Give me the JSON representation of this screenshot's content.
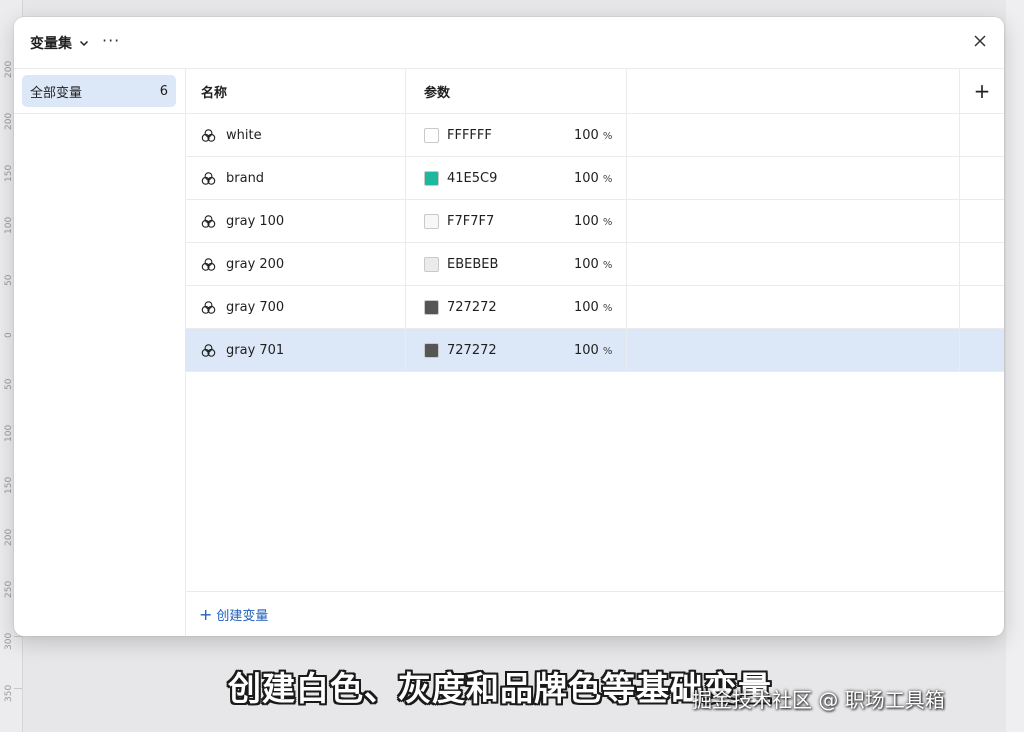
{
  "ruler": {
    "ticks": [
      "200",
      "200",
      "150",
      "100",
      "50",
      "0",
      "50",
      "100",
      "150",
      "200",
      "250",
      "300",
      "350"
    ]
  },
  "dialog": {
    "title": "变量集",
    "more": "···",
    "sidebar": {
      "items": [
        {
          "label": "全部变量",
          "count": "6"
        }
      ]
    },
    "table": {
      "headers": {
        "name": "名称",
        "value": "参数",
        "add": "+"
      },
      "rows": [
        {
          "name": "white",
          "hex": "FFFFFF",
          "opacity": "100",
          "unit": "%",
          "color": "#FFFFFF",
          "selected": false
        },
        {
          "name": "brand",
          "hex": "41E5C9",
          "opacity": "100",
          "unit": "%",
          "color": "#1FB89E",
          "selected": false
        },
        {
          "name": "gray 100",
          "hex": "F7F7F7",
          "opacity": "100",
          "unit": "%",
          "color": "#F7F7F7",
          "selected": false
        },
        {
          "name": "gray 200",
          "hex": "EBEBEB",
          "opacity": "100",
          "unit": "%",
          "color": "#EBEBEB",
          "selected": false
        },
        {
          "name": "gray 700",
          "hex": "727272",
          "opacity": "100",
          "unit": "%",
          "color": "#555555",
          "selected": false
        },
        {
          "name": "gray 701",
          "hex": "727272",
          "opacity": "100",
          "unit": "%",
          "color": "#555555",
          "selected": true
        }
      ]
    },
    "create_button": {
      "plus": "+",
      "label": "创建变量"
    }
  },
  "subtitle": "创建白色、灰度和品牌色等基础变量",
  "watermark": "掘金技术社区 @ 职场工具箱",
  "colors": {
    "accent": "#1f5fbf",
    "selection": "#dce8f7"
  }
}
